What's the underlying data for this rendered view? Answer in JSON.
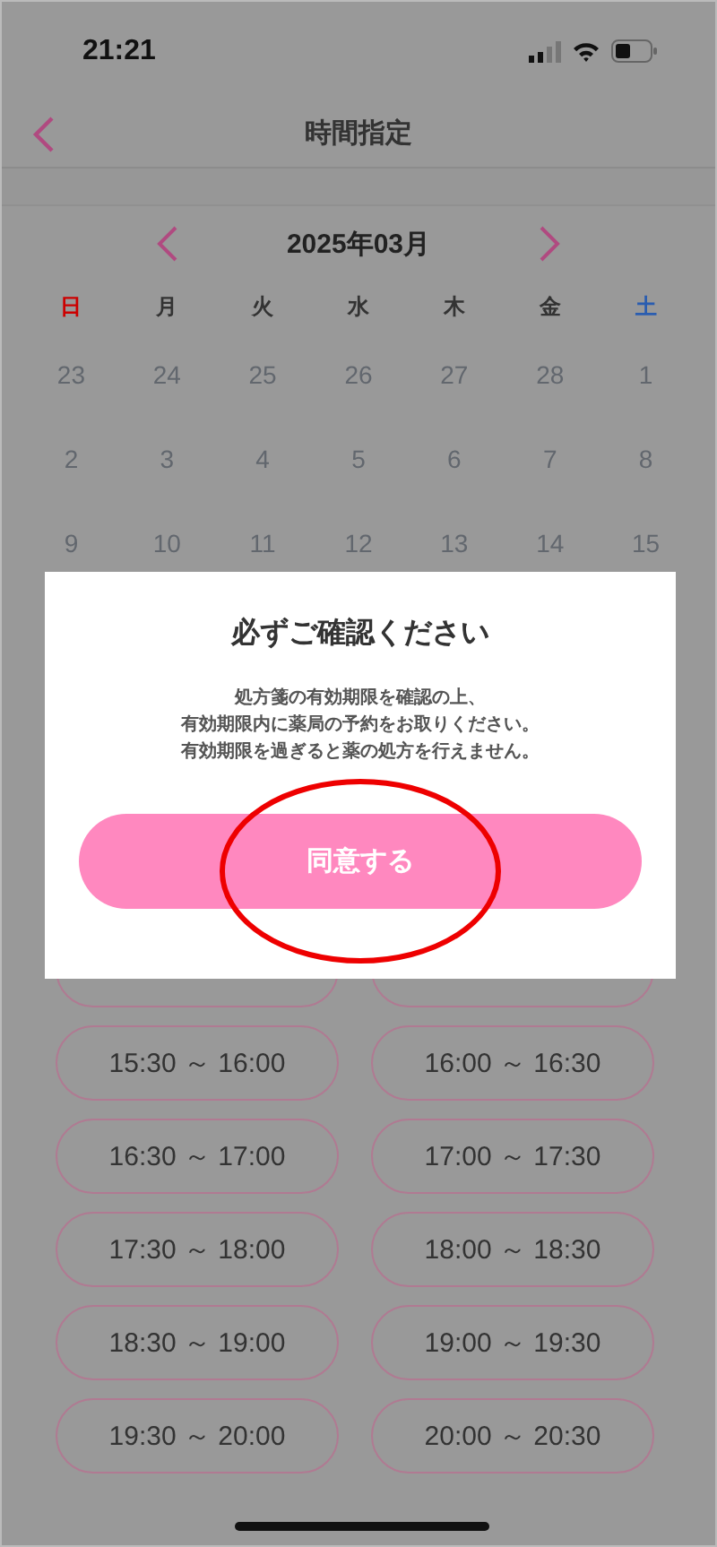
{
  "status_bar": {
    "time": "21:21"
  },
  "nav": {
    "title": "時間指定"
  },
  "calendar": {
    "month": "2025年03月",
    "weekdays": [
      {
        "label": "日",
        "kind": "sunday"
      },
      {
        "label": "月",
        "kind": "weekday"
      },
      {
        "label": "火",
        "kind": "weekday"
      },
      {
        "label": "水",
        "kind": "weekday"
      },
      {
        "label": "木",
        "kind": "weekday"
      },
      {
        "label": "金",
        "kind": "weekday"
      },
      {
        "label": "土",
        "kind": "saturday"
      }
    ],
    "weeks": [
      [
        "23",
        "24",
        "25",
        "26",
        "27",
        "28",
        "1"
      ],
      [
        "2",
        "3",
        "4",
        "5",
        "6",
        "7",
        "8"
      ],
      [
        "9",
        "10",
        "11",
        "12",
        "13",
        "14",
        "15"
      ]
    ]
  },
  "time_slots": [
    "15:30 ～ 16:00",
    "16:00 ～ 16:30",
    "16:30 ～ 17:00",
    "17:00 ～ 17:30",
    "17:30 ～ 18:00",
    "18:00 ～ 18:30",
    "18:30 ～ 19:00",
    "19:00 ～ 19:30",
    "19:30 ～ 20:00",
    "20:00 ～ 20:30"
  ],
  "dialog": {
    "title": "必ずご確認ください",
    "message": [
      "処方箋の有効期限を確認の上、",
      "有効期限内に薬局の予約をお取りください。",
      "有効期限を過ぎると薬の処方を行えません。"
    ],
    "button": "同意する"
  }
}
